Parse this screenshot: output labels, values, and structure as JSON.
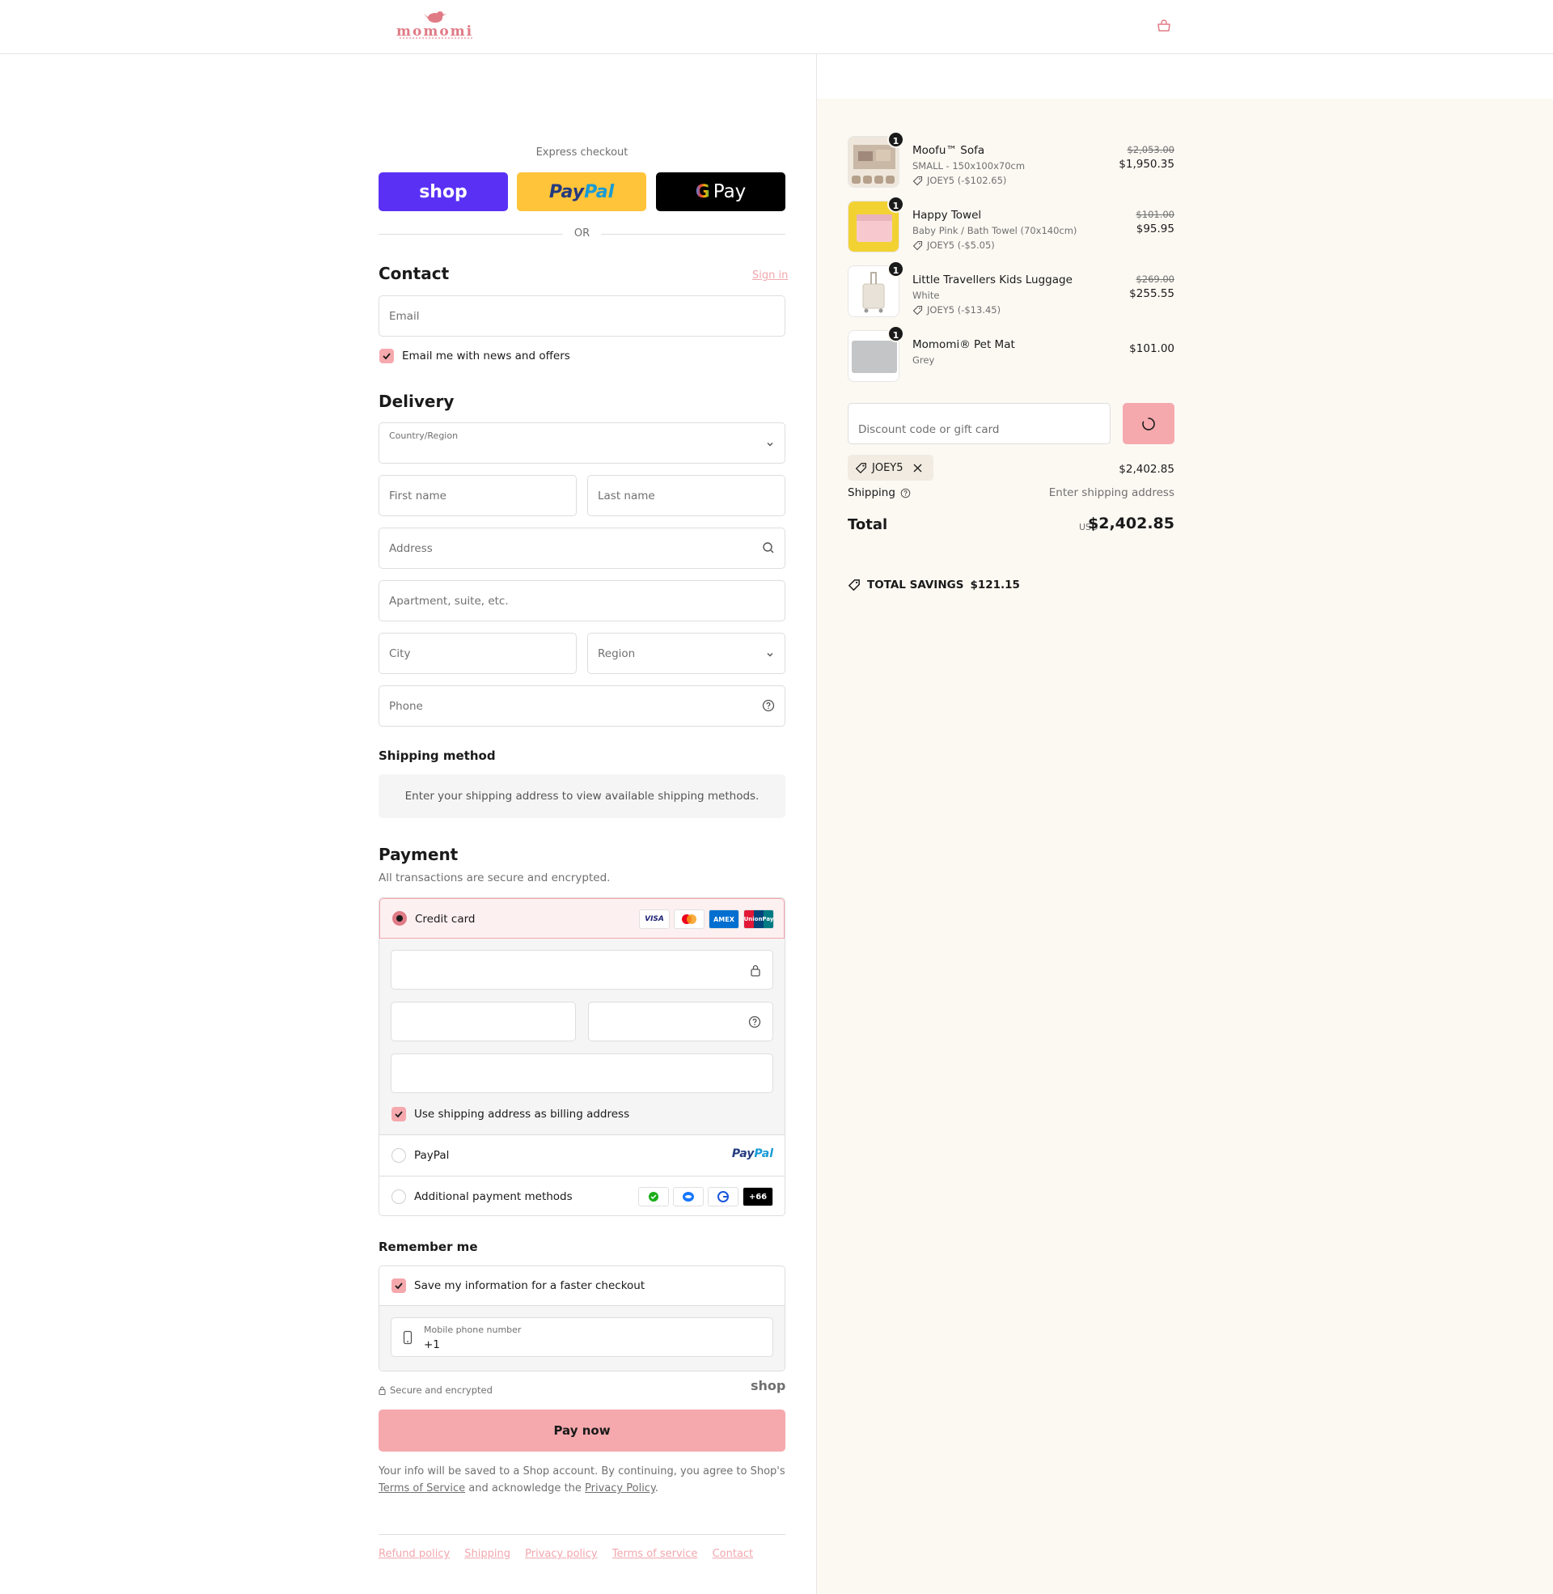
{
  "brand": {
    "logo_text": "momomi",
    "accent": "#f5a9ad",
    "link_color": "#f2a7ae"
  },
  "express": {
    "label": "Express checkout",
    "shop_label": "shop",
    "paypal_a": "Pay",
    "paypal_b": "Pal",
    "gpay_g": "G",
    "gpay_label": "Pay",
    "or": "OR"
  },
  "contact": {
    "title": "Contact",
    "sign_in": "Sign in",
    "email_placeholder": "Email",
    "news_label": "Email me with news and offers"
  },
  "delivery": {
    "title": "Delivery",
    "country_label": "Country/Region",
    "first_name": "First name",
    "last_name": "Last name",
    "address": "Address",
    "apartment": "Apartment, suite, etc.",
    "city": "City",
    "region": "Region",
    "phone": "Phone"
  },
  "shipping_method": {
    "title": "Shipping method",
    "info": "Enter your shipping address to view available shipping methods."
  },
  "payment": {
    "title": "Payment",
    "subtitle": "All transactions are secure and encrypted.",
    "credit_card": "Credit card",
    "cards": [
      "VISA",
      "MC",
      "AMEX",
      "UnionPay"
    ],
    "billing_same": "Use shipping address as billing address",
    "paypal": "PayPal",
    "paypal_logo_a": "Pay",
    "paypal_logo_b": "Pal",
    "additional": "Additional payment methods",
    "more_count": "+66"
  },
  "remember": {
    "title": "Remember me",
    "save_label": "Save my information for a faster checkout",
    "phone_label": "Mobile phone number",
    "phone_value": "+1"
  },
  "secure": {
    "label": "Secure and encrypted",
    "shop": "shop"
  },
  "pay_now": "Pay now",
  "legal": {
    "text1": "Your info will be saved to a Shop account. By continuing, you agree to Shop's",
    "tos": "Terms of Service",
    "text2": "and acknowledge the",
    "privacy": "Privacy Policy",
    "period": "."
  },
  "footer": {
    "links": [
      "Refund policy",
      "Shipping",
      "Privacy policy",
      "Terms of service",
      "Contact"
    ]
  },
  "cart": {
    "items": [
      {
        "qty": "1",
        "name": "Moofu™ Sofa",
        "variant": "SMALL - 150x100x70cm",
        "discount": "JOEY5 (-$102.65)",
        "old_price": "$2,053.00",
        "price": "$1,950.35"
      },
      {
        "qty": "1",
        "name": "Happy Towel",
        "variant": "Baby Pink / Bath Towel (70x140cm)",
        "discount": "JOEY5 (-$5.05)",
        "old_price": "$101.00",
        "price": "$95.95"
      },
      {
        "qty": "1",
        "name": "Little Travellers Kids Luggage",
        "variant": "White",
        "discount": "JOEY5 (-$13.45)",
        "old_price": "$269.00",
        "price": "$255.55"
      },
      {
        "qty": "1",
        "name": "Momomi® Pet Mat",
        "variant": "Grey",
        "price": "$101.00"
      }
    ],
    "discount_placeholder": "Discount code or gift card",
    "code": "JOEY5",
    "subtotal": "$2,402.85",
    "shipping_label": "Shipping",
    "shipping_value": "Enter shipping address",
    "total_label": "Total",
    "currency": "USD",
    "total": "$2,402.85",
    "savings_label": "TOTAL SAVINGS",
    "savings_value": "$121.15"
  }
}
